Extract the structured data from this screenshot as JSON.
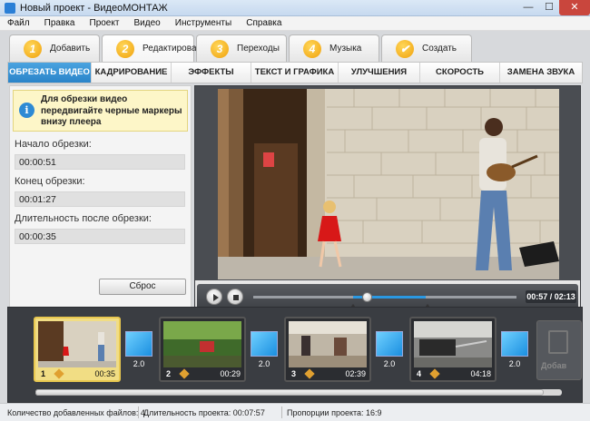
{
  "window": {
    "title": "Новый проект - ВидеоМОНТАЖ",
    "minimize_glyph": "—",
    "maximize_glyph": "☐",
    "close_glyph": "✕",
    "icon": "app-icon"
  },
  "menu": [
    "Файл",
    "Правка",
    "Проект",
    "Видео",
    "Инструменты",
    "Справка"
  ],
  "steps": [
    {
      "num": "1",
      "label": "Добавить"
    },
    {
      "num": "2",
      "label": "Редактировать"
    },
    {
      "num": "3",
      "label": "Переходы"
    },
    {
      "num": "4",
      "label": "Музыка"
    },
    {
      "num": "✔",
      "label": "Создать"
    }
  ],
  "subtabs": [
    "ОБРЕЗАТЬ ВИДЕО",
    "КАДРИРОВАНИЕ",
    "ЭФФЕКТЫ",
    "ТЕКСТ И ГРАФИКА",
    "УЛУЧШЕНИЯ",
    "СКОРОСТЬ",
    "ЗАМЕНА ЗВУКА"
  ],
  "trim": {
    "hint": "Для обрезки видео передвигайте черные маркеры внизу плеера",
    "start_label": "Начало обрезки:",
    "start_value": "00:00:51",
    "end_label": "Конец обрезки:",
    "end_value": "00:01:27",
    "length_label": "Длительность после обрезки:",
    "length_value": "00:00:35",
    "reset_label": "Сброс"
  },
  "player": {
    "time": "00:57 / 02:13",
    "progress": 0.43
  },
  "clips": [
    {
      "index": "1",
      "duration": "00:35",
      "active": true
    },
    {
      "index": "2",
      "duration": "00:29",
      "active": false
    },
    {
      "index": "3",
      "duration": "02:39",
      "active": false
    },
    {
      "index": "4",
      "duration": "04:18",
      "active": false
    }
  ],
  "transitions": [
    "2.0",
    "2.0",
    "2.0",
    "2.0"
  ],
  "add_clip_label": "Добав",
  "status": {
    "files": "Количество добавленных файлов: 4",
    "duration": "Длительность проекта: 00:07:57",
    "ratio": "Пропорции проекта: 16:9"
  },
  "colors": {
    "accent": "#2a84c9",
    "step_badge": "#f0a10b",
    "hint_bg": "#fdf6c8",
    "close_button": "#c9463d"
  }
}
